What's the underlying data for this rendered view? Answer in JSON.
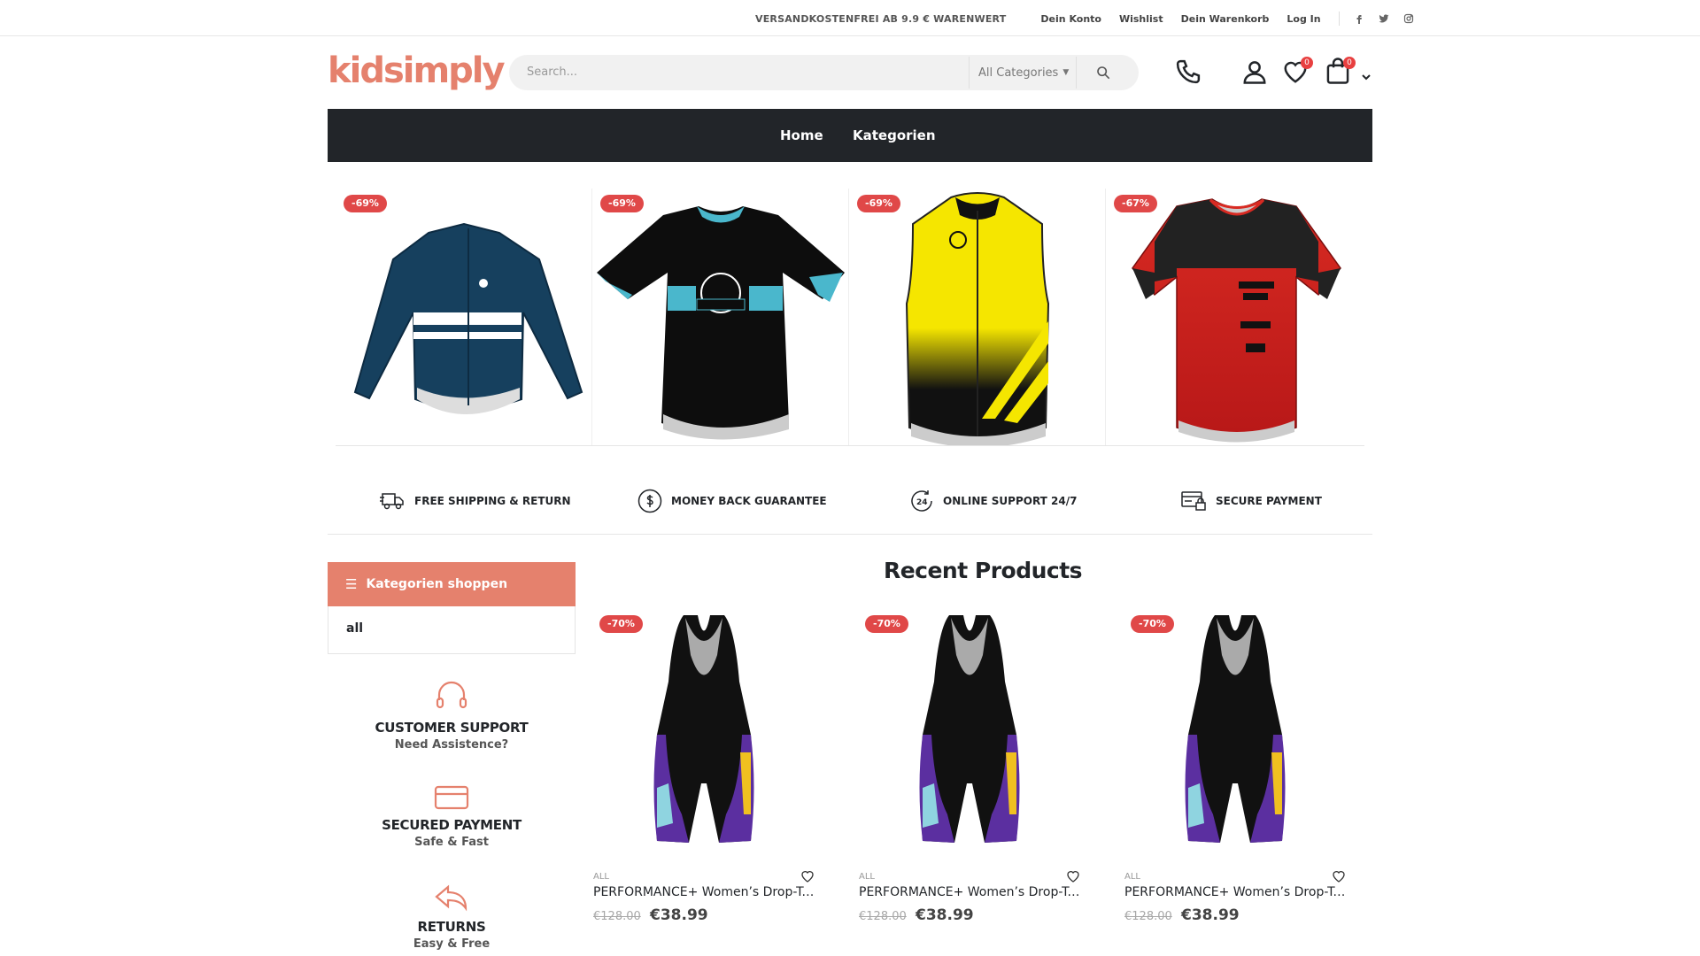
{
  "topbar": {
    "shipping": "VERSANDKOSTENFREI AB 9.9 € WARENWERT",
    "links": [
      "Dein Konto",
      "Wishlist",
      "Dein Warenkorb",
      "Log In"
    ],
    "social": [
      "facebook-icon",
      "twitter-icon",
      "instagram-icon"
    ]
  },
  "header": {
    "logo": "kidsimply",
    "search_placeholder": "Search...",
    "category_select": "All Categories",
    "wishlist_count": "0",
    "cart_count": "0"
  },
  "nav": {
    "items": [
      "Home",
      "Kategorien"
    ]
  },
  "featured": [
    {
      "discount": "-69%",
      "image": "navy-long-sleeve-jersey"
    },
    {
      "discount": "-69%",
      "image": "black-oldenburg-jersey"
    },
    {
      "discount": "-69%",
      "image": "yellow-black-vest"
    },
    {
      "discount": "-67%",
      "image": "red-black-jersey"
    }
  ],
  "info_boxes": [
    "FREE SHIPPING & RETURN",
    "MONEY BACK GUARANTEE",
    "ONLINE SUPPORT 24/7",
    "SECURE PAYMENT"
  ],
  "sidebar": {
    "heading": "Kategorien shoppen",
    "categories": [
      "all"
    ],
    "features": [
      {
        "title": "CUSTOMER SUPPORT",
        "subtitle": "Need Assistence?"
      },
      {
        "title": "SECURED PAYMENT",
        "subtitle": "Safe & Fast"
      },
      {
        "title": "RETURNS",
        "subtitle": "Easy & Free"
      }
    ]
  },
  "recent": {
    "title": "Recent Products",
    "products": [
      {
        "discount": "-70%",
        "category": "ALL",
        "name": "PERFORMANCE+ Women’s Drop-Tail Bib Shorts",
        "old_price": "€128.00",
        "price": "€38.99"
      },
      {
        "discount": "-70%",
        "category": "ALL",
        "name": "PERFORMANCE+ Women’s Drop-Tail Bib Shorts",
        "old_price": "€128.00",
        "price": "€38.99"
      },
      {
        "discount": "-70%",
        "category": "ALL",
        "name": "PERFORMANCE+ Women’s Drop-Tail Bib Shorts",
        "old_price": "€128.00",
        "price": "€38.99"
      }
    ]
  },
  "colors": {
    "accent": "#e5816d",
    "nav_bg": "#222529",
    "discount": "#e04848"
  }
}
